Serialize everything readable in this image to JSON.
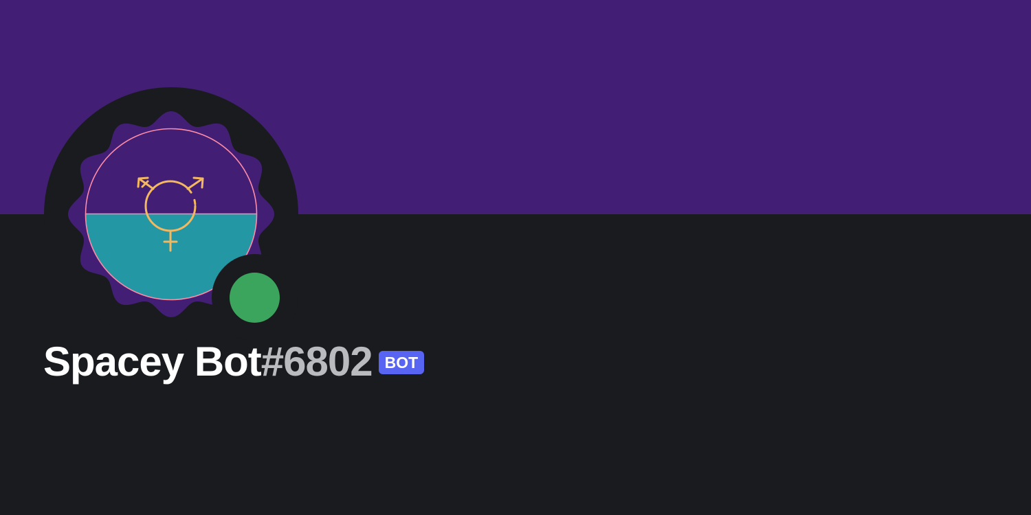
{
  "profile": {
    "banner_color": "#421f75",
    "background_color": "#1a1b1e",
    "avatar": {
      "icon": "transgender-symbol-icon",
      "top_color": "#421f75",
      "bottom_color": "#2397a3",
      "ring_color": "#ff8ca8",
      "symbol_color": "#f4b860"
    },
    "status": {
      "state": "online",
      "color": "#3ba55d"
    },
    "username": "Spacey Bot",
    "discriminator": "#6802",
    "tag": {
      "label": "BOT",
      "color": "#5865f2"
    }
  }
}
